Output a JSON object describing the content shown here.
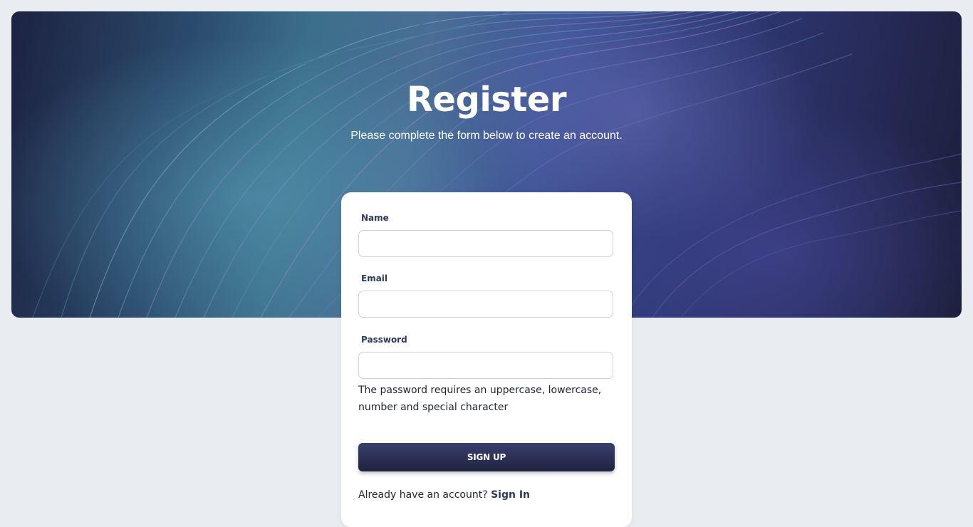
{
  "hero": {
    "title": "Register",
    "subtitle": "Please complete the form below to create an account."
  },
  "form": {
    "name_label": "Name",
    "name_value": "",
    "email_label": "Email",
    "email_value": "",
    "password_label": "Password",
    "password_value": "",
    "password_hint": "The password requires an uppercase, lowercase, number and special character",
    "submit_label": "SIGN UP",
    "footer_text": "Already have an account?",
    "signin_label": "Sign In"
  },
  "colors": {
    "page_background": "#e9ecf1",
    "button_top": "#3a3f6e",
    "button_bottom": "#1f2340",
    "label_text": "#2d3a5a"
  }
}
